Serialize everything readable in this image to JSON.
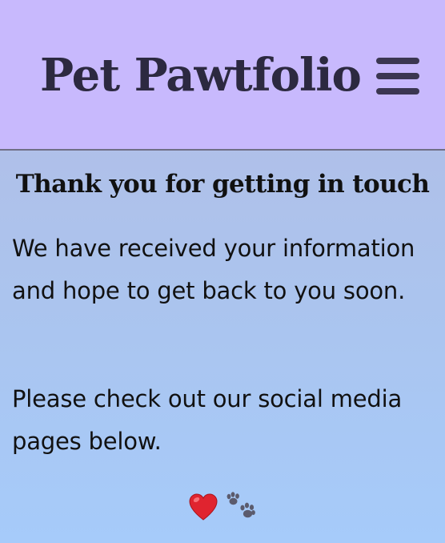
{
  "header": {
    "title": "Pet Pawtfolio",
    "menu_icon": "hamburger-menu-icon",
    "background_color": "#c8b9fd"
  },
  "main": {
    "heading": "Thank you for getting in touch",
    "paragraph_1": "We have received your information and hope to get back to you soon.",
    "paragraph_2": "Please check out our social media pages below.",
    "social_icons": [
      "heart-icon",
      "paw-prints-icon"
    ]
  },
  "colors": {
    "title_text": "#2c2940",
    "heart": "#e0242f",
    "paw": "#5b5b6d",
    "gradient_top": "#b4bce4",
    "gradient_bottom": "#a6cbfa"
  }
}
